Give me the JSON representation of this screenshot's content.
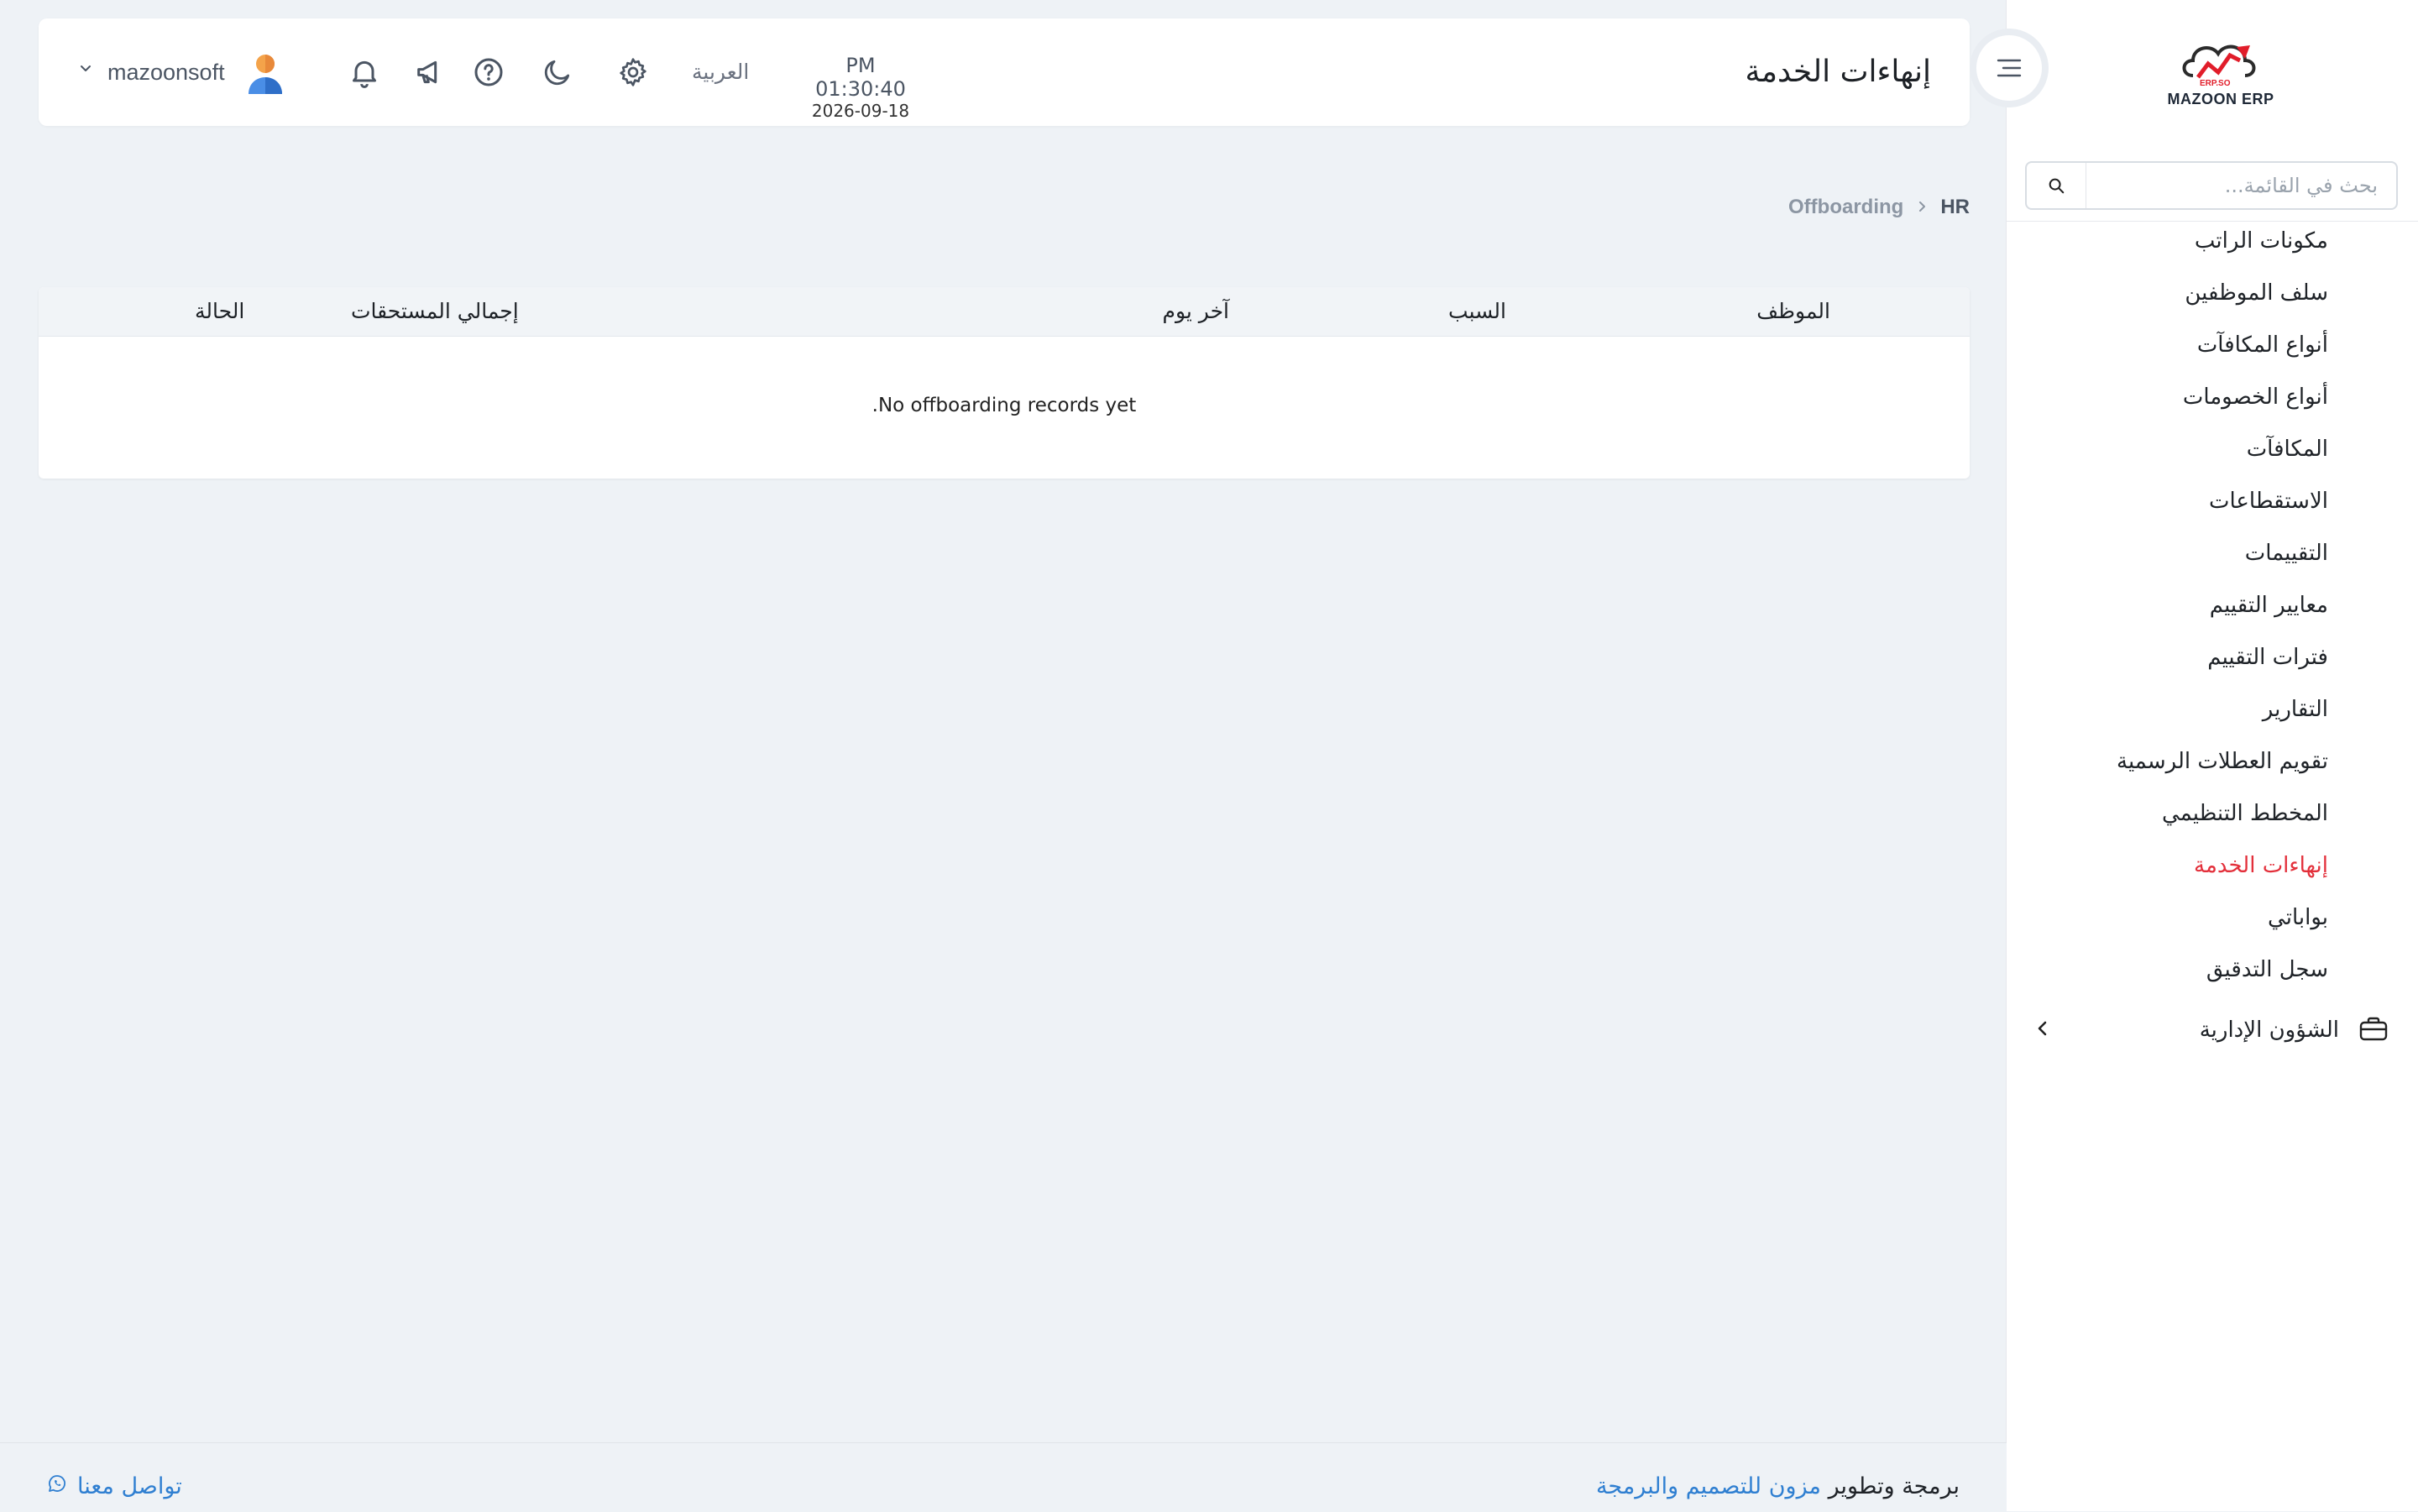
{
  "app": {
    "logo_text": "MAZOON ERP",
    "logo_small": "ERP.SO"
  },
  "header": {
    "page_title": "إنهاءات الخدمة",
    "time": "PM 01:30:40",
    "date": "2026-09-18",
    "language": "العربية",
    "username": "mazoonsoft"
  },
  "search": {
    "placeholder": "بحث في القائمة..."
  },
  "sidebar": {
    "items": [
      {
        "label": "مكونات الراتب"
      },
      {
        "label": "سلف الموظفين"
      },
      {
        "label": "أنواع المكافآت"
      },
      {
        "label": "أنواع الخصومات"
      },
      {
        "label": "المكافآت"
      },
      {
        "label": "الاستقطاعات"
      },
      {
        "label": "التقييمات"
      },
      {
        "label": "معايير التقييم"
      },
      {
        "label": "فترات التقييم"
      },
      {
        "label": "التقارير"
      },
      {
        "label": "تقويم العطلات الرسمية"
      },
      {
        "label": "المخطط التنظيمي"
      },
      {
        "label": "إنهاءات الخدمة",
        "active": true
      },
      {
        "label": "بواباتي"
      },
      {
        "label": "سجل التدقيق"
      }
    ],
    "section": {
      "label": "الشؤون الإدارية"
    }
  },
  "breadcrumb": {
    "root": "HR",
    "current": "Offboarding"
  },
  "table": {
    "columns": [
      "الموظف",
      "السبب",
      "آخر يوم",
      "إجمالي المستحقات",
      "الحالة"
    ],
    "rows": [],
    "empty_message": "No offboarding records yet."
  },
  "footer": {
    "credit_prefix": "برمجة وتطوير",
    "credit_link": "مزون للتصميم والبرمجة",
    "contact": "تواصل معنا"
  },
  "colors": {
    "accent": "#e3303b",
    "link": "#2f7fd1",
    "background": "#eef2f6"
  }
}
